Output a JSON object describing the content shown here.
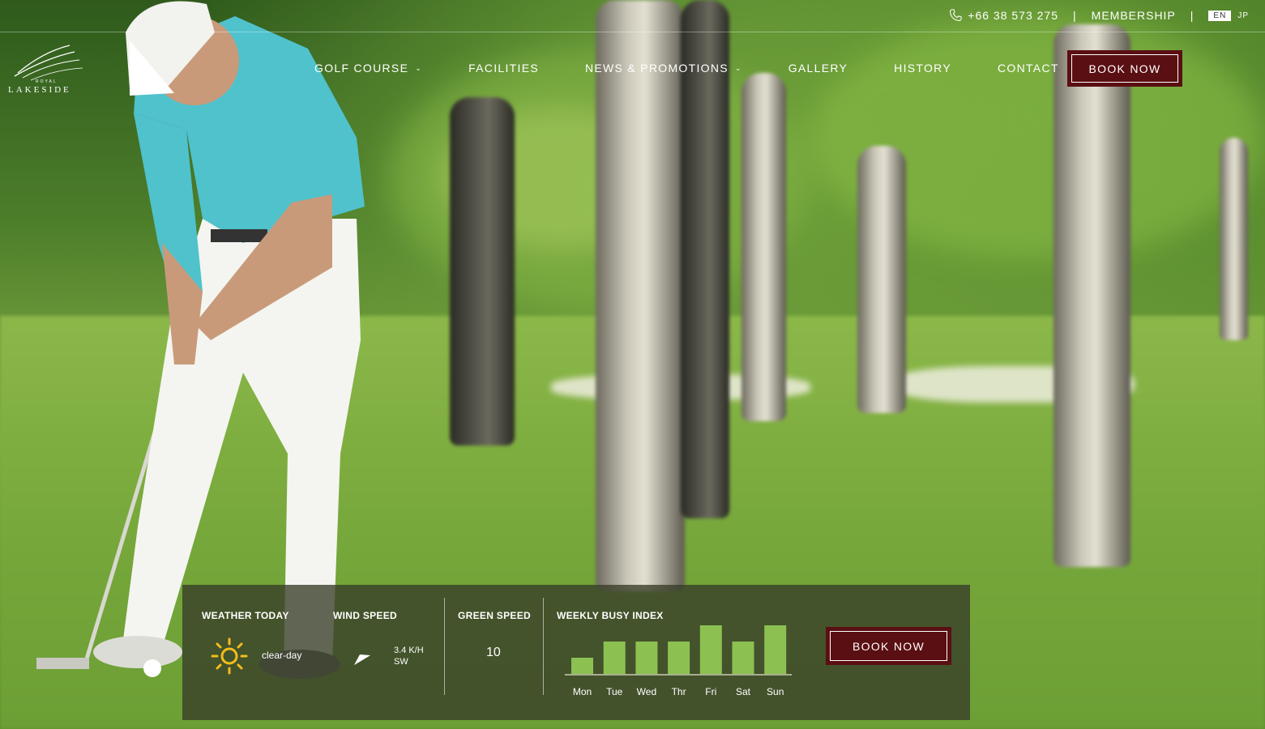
{
  "topbar": {
    "phone_icon": "phone-icon",
    "phone": "+66 38 573 275",
    "separator": "|",
    "membership": "MEMBERSHIP",
    "lang_en": "EN",
    "lang_jp": "JP"
  },
  "logo": {
    "royal": "ROYAL",
    "name": "LAKESIDE"
  },
  "nav": {
    "items": [
      {
        "label": "GOLF COURSE",
        "dropdown": true
      },
      {
        "label": "FACILITIES"
      },
      {
        "label": "NEWS & PROMOTIONS",
        "dropdown": true
      },
      {
        "label": "GALLERY"
      },
      {
        "label": "HISTORY"
      },
      {
        "label": "CONTACT"
      }
    ],
    "chevron": "⌄",
    "book_now": "BOOK NOW"
  },
  "panel": {
    "weather_label": "WEATHER TODAY",
    "weather_icon": "sun-icon",
    "weather_text": "clear-day",
    "wind_label": "WIND SPEED",
    "wind_icon": "wind-direction-icon",
    "wind_value": "3.4 K/H",
    "wind_dir": "SW",
    "green_label": "GREEN SPEED",
    "green_value": "10",
    "busy_label": "WEEKLY BUSY INDEX",
    "book_now": "BOOK NOW"
  },
  "chart_data": {
    "type": "bar",
    "title": "WEEKLY BUSY INDEX",
    "categories": [
      "Mon",
      "Tue",
      "Wed",
      "Thr",
      "Fri",
      "Sat",
      "Sun"
    ],
    "values": [
      1,
      2,
      2,
      2,
      3,
      2,
      3
    ],
    "ylim": [
      0,
      3
    ],
    "bar_color": "#8cc152",
    "grid": false
  },
  "colors": {
    "accent": "#5a0f12",
    "panel": "#373c28",
    "bar": "#8cc152"
  }
}
